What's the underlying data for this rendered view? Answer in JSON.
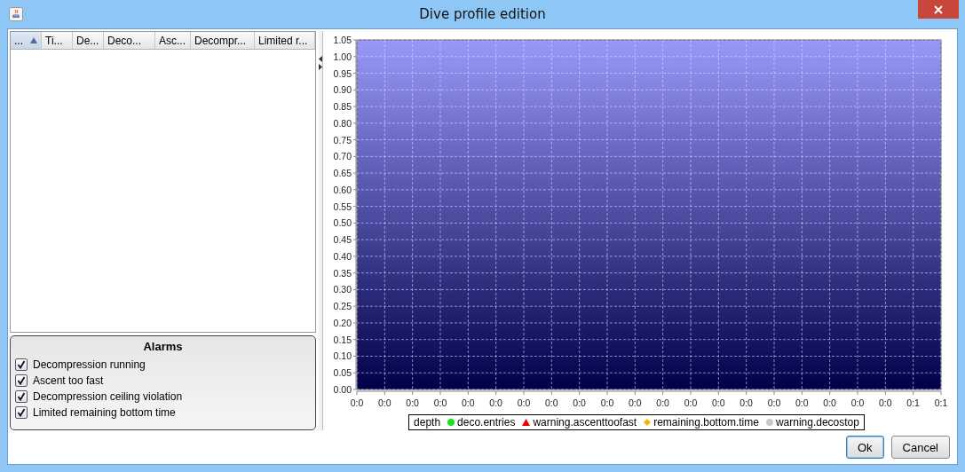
{
  "window": {
    "title": "Dive profile edition"
  },
  "table": {
    "columns": [
      {
        "label": "...",
        "sorted": true
      },
      {
        "label": "Ti...",
        "sorted": false
      },
      {
        "label": "De...",
        "sorted": false
      },
      {
        "label": "Deco...",
        "sorted": false
      },
      {
        "label": "Asc...",
        "sorted": false
      },
      {
        "label": "Decompr...",
        "sorted": false
      },
      {
        "label": "Limited r...",
        "sorted": false
      }
    ]
  },
  "alarms": {
    "title": "Alarms",
    "items": [
      {
        "label": "Decompression running",
        "checked": true
      },
      {
        "label": "Ascent too fast",
        "checked": true
      },
      {
        "label": "Decompression ceiling violation",
        "checked": true
      },
      {
        "label": "Limited remaining bottom time",
        "checked": true
      }
    ]
  },
  "chart": {
    "chart_data": {
      "type": "line",
      "grid": true,
      "ylim": [
        0,
        1.05
      ],
      "yticks": [
        {
          "value": 0,
          "label": "0.00"
        },
        {
          "value": 0.05,
          "label": "0.05"
        },
        {
          "value": 0.1,
          "label": "0.10"
        },
        {
          "value": 0.15,
          "label": "0.15"
        },
        {
          "value": 0.2,
          "label": "0.20"
        },
        {
          "value": 0.25,
          "label": "0.25"
        },
        {
          "value": 0.3,
          "label": "0.30"
        },
        {
          "value": 0.35,
          "label": "0.35"
        },
        {
          "value": 0.4,
          "label": "0.40"
        },
        {
          "value": 0.45,
          "label": "0.45"
        },
        {
          "value": 0.5,
          "label": "0.50"
        },
        {
          "value": 0.55,
          "label": "0.55"
        },
        {
          "value": 0.6,
          "label": "0.60"
        },
        {
          "value": 0.65,
          "label": "0.65"
        },
        {
          "value": 0.7,
          "label": "0.70"
        },
        {
          "value": 0.75,
          "label": "0.75"
        },
        {
          "value": 0.8,
          "label": "0.80"
        },
        {
          "value": 0.85,
          "label": "0.85"
        },
        {
          "value": 0.9,
          "label": "0.90"
        },
        {
          "value": 0.95,
          "label": "0.95"
        },
        {
          "value": 1.0,
          "label": "1.00"
        },
        {
          "value": 1.05,
          "label": "1.05"
        }
      ],
      "categories": [
        "0:0",
        "0:0",
        "0:0",
        "0:0",
        "0:0",
        "0:0",
        "0:0",
        "0:0",
        "0:0",
        "0:0",
        "0:0",
        "0:0",
        "0:0",
        "0:0",
        "0:0",
        "0:0",
        "0:0",
        "0:0",
        "0:0",
        "0:0",
        "0:1",
        "0:1"
      ]
    },
    "legend": [
      {
        "label": "depth",
        "kind": "none"
      },
      {
        "label": "deco.entries",
        "kind": "circle",
        "color": "#22dd22"
      },
      {
        "label": "warning.ascenttoofast",
        "kind": "triangle",
        "color": "#ee0000"
      },
      {
        "label": "remaining.bottom.time",
        "kind": "diamond",
        "color": "#f0b800"
      },
      {
        "label": "warning.decostop",
        "kind": "circle",
        "color": "#c8c8d0"
      }
    ]
  },
  "buttons": [
    {
      "label": "Ok",
      "focused": true
    },
    {
      "label": "Cancel",
      "focused": false
    }
  ]
}
